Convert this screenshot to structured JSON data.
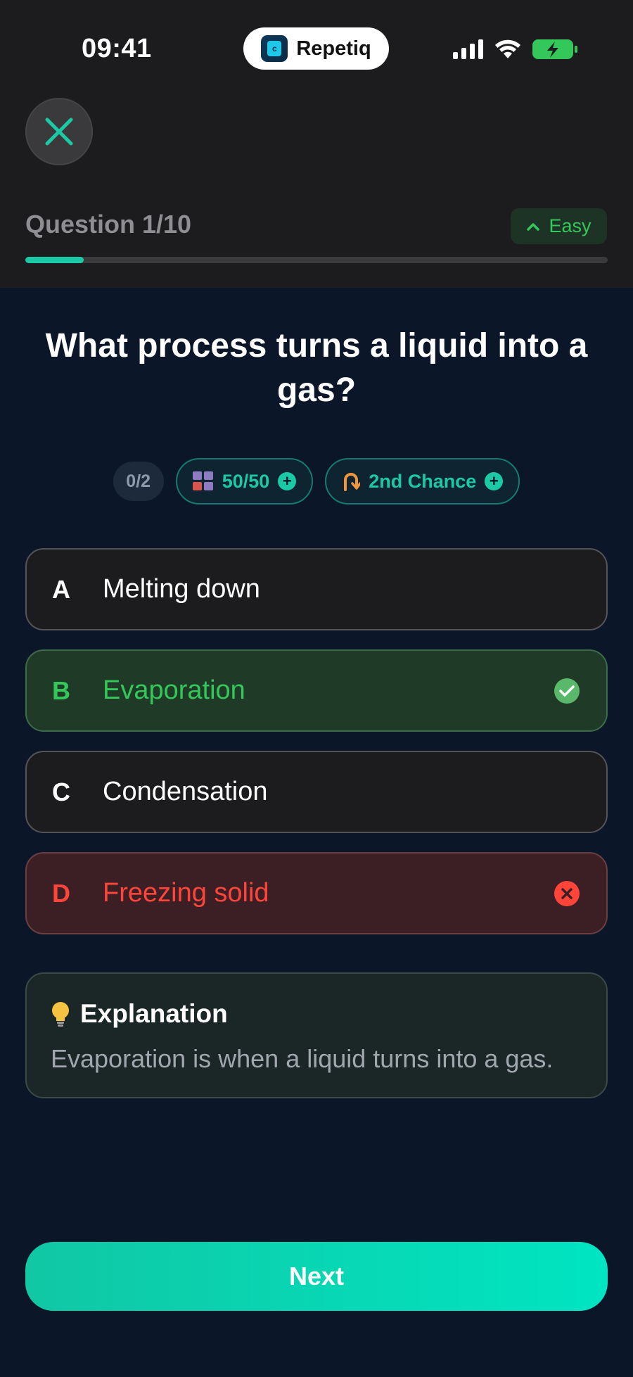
{
  "status_bar": {
    "time": "09:41",
    "app_name": "Repetiq",
    "icons": [
      "signal-icon",
      "wifi-icon",
      "battery-charging-icon"
    ]
  },
  "header": {
    "close_icon": "close-icon",
    "question_label": "Question 1/10",
    "difficulty": "Easy",
    "progress": 0.1
  },
  "question": {
    "text": "What process turns a liquid into a gas?"
  },
  "lifelines": {
    "used_count": "0/2",
    "fifty_fifty": "50/50",
    "second_chance": "2nd Chance"
  },
  "options": [
    {
      "letter": "A",
      "text": "Melting down",
      "state": "neutral"
    },
    {
      "letter": "B",
      "text": "Evaporation",
      "state": "correct"
    },
    {
      "letter": "C",
      "text": "Condensation",
      "state": "neutral"
    },
    {
      "letter": "D",
      "text": "Freezing solid",
      "state": "wrong"
    }
  ],
  "explanation": {
    "title": "Explanation",
    "body": "Evaporation is when a liquid turns into a gas."
  },
  "footer": {
    "next_label": "Next"
  },
  "colors": {
    "accent": "#1cc9a6",
    "correct": "#34c759",
    "wrong": "#ff453a",
    "background": "#0b1628"
  }
}
